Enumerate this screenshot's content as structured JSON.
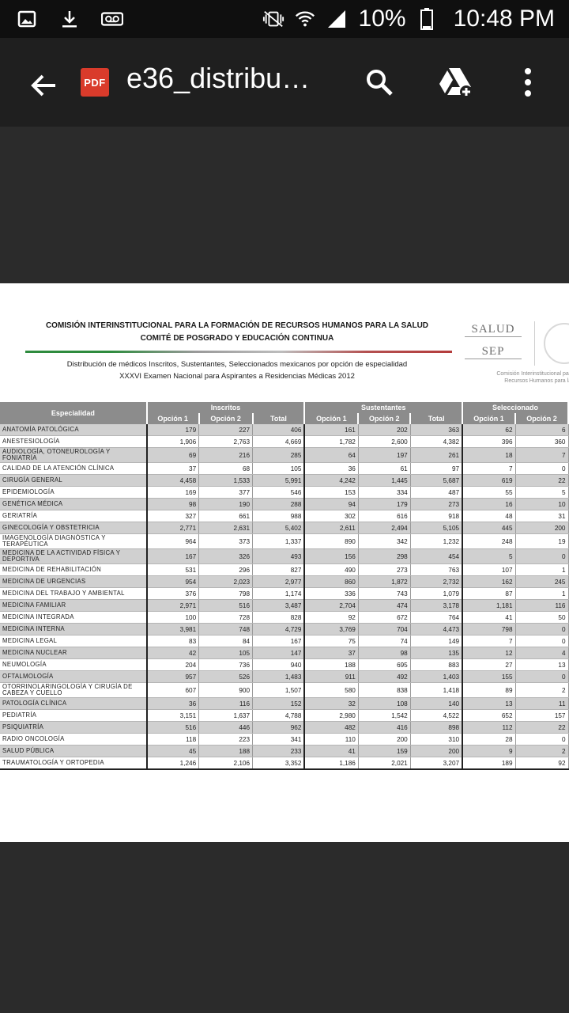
{
  "status_bar": {
    "battery": "10%",
    "time": "10:48 PM",
    "left_icons": [
      "image-icon",
      "download-icon",
      "voicemail-icon"
    ],
    "right_icons": [
      "vibrate-icon",
      "wifi-icon",
      "signal-icon",
      "battery-icon"
    ]
  },
  "app_bar": {
    "badge": "PDF",
    "title": "e36_distribu…"
  },
  "document": {
    "header_line1": "COMISIÓN INTERINSTITUCIONAL PARA LA FORMACIÓN DE RECURSOS HUMANOS PARA LA SALUD",
    "header_line2": "COMITÉ DE POSGRADO Y EDUCACIÓN CONTINUA",
    "subtitle_line1": "Distribución de médicos Inscritos,  Sustentantes,  Seleccionados mexicanos por opción de especialidad",
    "subtitle_line2": "XXXVI Examen Nacional para Aspirantes a Residencias Médicas 2012",
    "logo_word1": "SALUD",
    "logo_word2": "SEP",
    "logo_caption1": "Comisión Interinstitucional para la F",
    "logo_caption2": "Recursos Humanos para la S"
  },
  "table": {
    "col_especialidad": "Especialidad",
    "group_inscritos": "Inscritos",
    "group_sustentantes": "Sustentantes",
    "group_seleccionados": "Seleccionado",
    "opcion1": "Opción 1",
    "opcion2": "Opción 2",
    "total": "Total",
    "rows": [
      {
        "name": "ANATOMÍA PATOLÓGICA",
        "v": [
          "179",
          "227",
          "406",
          "161",
          "202",
          "363",
          "62",
          "6"
        ]
      },
      {
        "name": "ANESTESIOLOGÍA",
        "v": [
          "1,906",
          "2,763",
          "4,669",
          "1,782",
          "2,600",
          "4,382",
          "396",
          "360"
        ]
      },
      {
        "name": "AUDIOLOGÍA, OTONEUROLOGÍA Y FONIATRÍA",
        "v": [
          "69",
          "216",
          "285",
          "64",
          "197",
          "261",
          "18",
          "7"
        ]
      },
      {
        "name": "CALIDAD DE LA ATENCIÓN CLÍNICA",
        "v": [
          "37",
          "68",
          "105",
          "36",
          "61",
          "97",
          "7",
          "0"
        ]
      },
      {
        "name": "CIRUGÍA GENERAL",
        "v": [
          "4,458",
          "1,533",
          "5,991",
          "4,242",
          "1,445",
          "5,687",
          "619",
          "22"
        ]
      },
      {
        "name": "EPIDEMIOLOGÍA",
        "v": [
          "169",
          "377",
          "546",
          "153",
          "334",
          "487",
          "55",
          "5"
        ]
      },
      {
        "name": "GENÉTICA MÉDICA",
        "v": [
          "98",
          "190",
          "288",
          "94",
          "179",
          "273",
          "16",
          "10"
        ]
      },
      {
        "name": "GERIATRÍA",
        "v": [
          "327",
          "661",
          "988",
          "302",
          "616",
          "918",
          "48",
          "31"
        ]
      },
      {
        "name": "GINECOLOGÍA Y OBSTETRICIA",
        "v": [
          "2,771",
          "2,631",
          "5,402",
          "2,611",
          "2,494",
          "5,105",
          "445",
          "200"
        ]
      },
      {
        "name": "IMAGENOLOGÍA DIAGNÓSTICA Y TERAPÉUTICA",
        "v": [
          "964",
          "373",
          "1,337",
          "890",
          "342",
          "1,232",
          "248",
          "19"
        ]
      },
      {
        "name": "MEDICINA DE LA ACTIVIDAD FÍSICA Y DEPORTIVA",
        "v": [
          "167",
          "326",
          "493",
          "156",
          "298",
          "454",
          "5",
          "0"
        ]
      },
      {
        "name": "MEDICINA DE REHABILITACIÓN",
        "v": [
          "531",
          "296",
          "827",
          "490",
          "273",
          "763",
          "107",
          "1"
        ]
      },
      {
        "name": "MEDICINA DE URGENCIAS",
        "v": [
          "954",
          "2,023",
          "2,977",
          "860",
          "1,872",
          "2,732",
          "162",
          "245"
        ]
      },
      {
        "name": "MEDICINA DEL TRABAJO Y AMBIENTAL",
        "v": [
          "376",
          "798",
          "1,174",
          "336",
          "743",
          "1,079",
          "87",
          "1"
        ]
      },
      {
        "name": "MEDICINA FAMILIAR",
        "v": [
          "2,971",
          "516",
          "3,487",
          "2,704",
          "474",
          "3,178",
          "1,181",
          "116"
        ]
      },
      {
        "name": "MEDICINA INTEGRADA",
        "v": [
          "100",
          "728",
          "828",
          "92",
          "672",
          "764",
          "41",
          "50"
        ]
      },
      {
        "name": "MEDICINA INTERNA",
        "v": [
          "3,981",
          "748",
          "4,729",
          "3,769",
          "704",
          "4,473",
          "798",
          "0"
        ]
      },
      {
        "name": "MEDICINA LEGAL",
        "v": [
          "83",
          "84",
          "167",
          "75",
          "74",
          "149",
          "7",
          "0"
        ]
      },
      {
        "name": "MEDICINA NUCLEAR",
        "v": [
          "42",
          "105",
          "147",
          "37",
          "98",
          "135",
          "12",
          "4"
        ]
      },
      {
        "name": "NEUMOLOGÍA",
        "v": [
          "204",
          "736",
          "940",
          "188",
          "695",
          "883",
          "27",
          "13"
        ]
      },
      {
        "name": "OFTALMOLOGÍA",
        "v": [
          "957",
          "526",
          "1,483",
          "911",
          "492",
          "1,403",
          "155",
          "0"
        ]
      },
      {
        "name": "OTORRINOLARINGOLOGÍA Y CIRUGÍA DE CABEZA Y CUELLO",
        "v": [
          "607",
          "900",
          "1,507",
          "580",
          "838",
          "1,418",
          "89",
          "2"
        ]
      },
      {
        "name": "PATOLOGÍA CLÍNICA",
        "v": [
          "36",
          "116",
          "152",
          "32",
          "108",
          "140",
          "13",
          "11"
        ]
      },
      {
        "name": "PEDIATRÍA",
        "v": [
          "3,151",
          "1,637",
          "4,788",
          "2,980",
          "1,542",
          "4,522",
          "652",
          "157"
        ]
      },
      {
        "name": "PSIQUIATRÍA",
        "v": [
          "516",
          "446",
          "962",
          "482",
          "416",
          "898",
          "112",
          "22"
        ]
      },
      {
        "name": "RADIO ONCOLOGÍA",
        "v": [
          "118",
          "223",
          "341",
          "110",
          "200",
          "310",
          "28",
          "0"
        ]
      },
      {
        "name": "SALUD PÚBLICA",
        "v": [
          "45",
          "188",
          "233",
          "41",
          "159",
          "200",
          "9",
          "2"
        ]
      },
      {
        "name": "TRAUMATOLOGÍA Y ORTOPEDIA",
        "v": [
          "1,246",
          "2,106",
          "3,352",
          "1,186",
          "2,021",
          "3,207",
          "189",
          "92"
        ]
      }
    ]
  }
}
